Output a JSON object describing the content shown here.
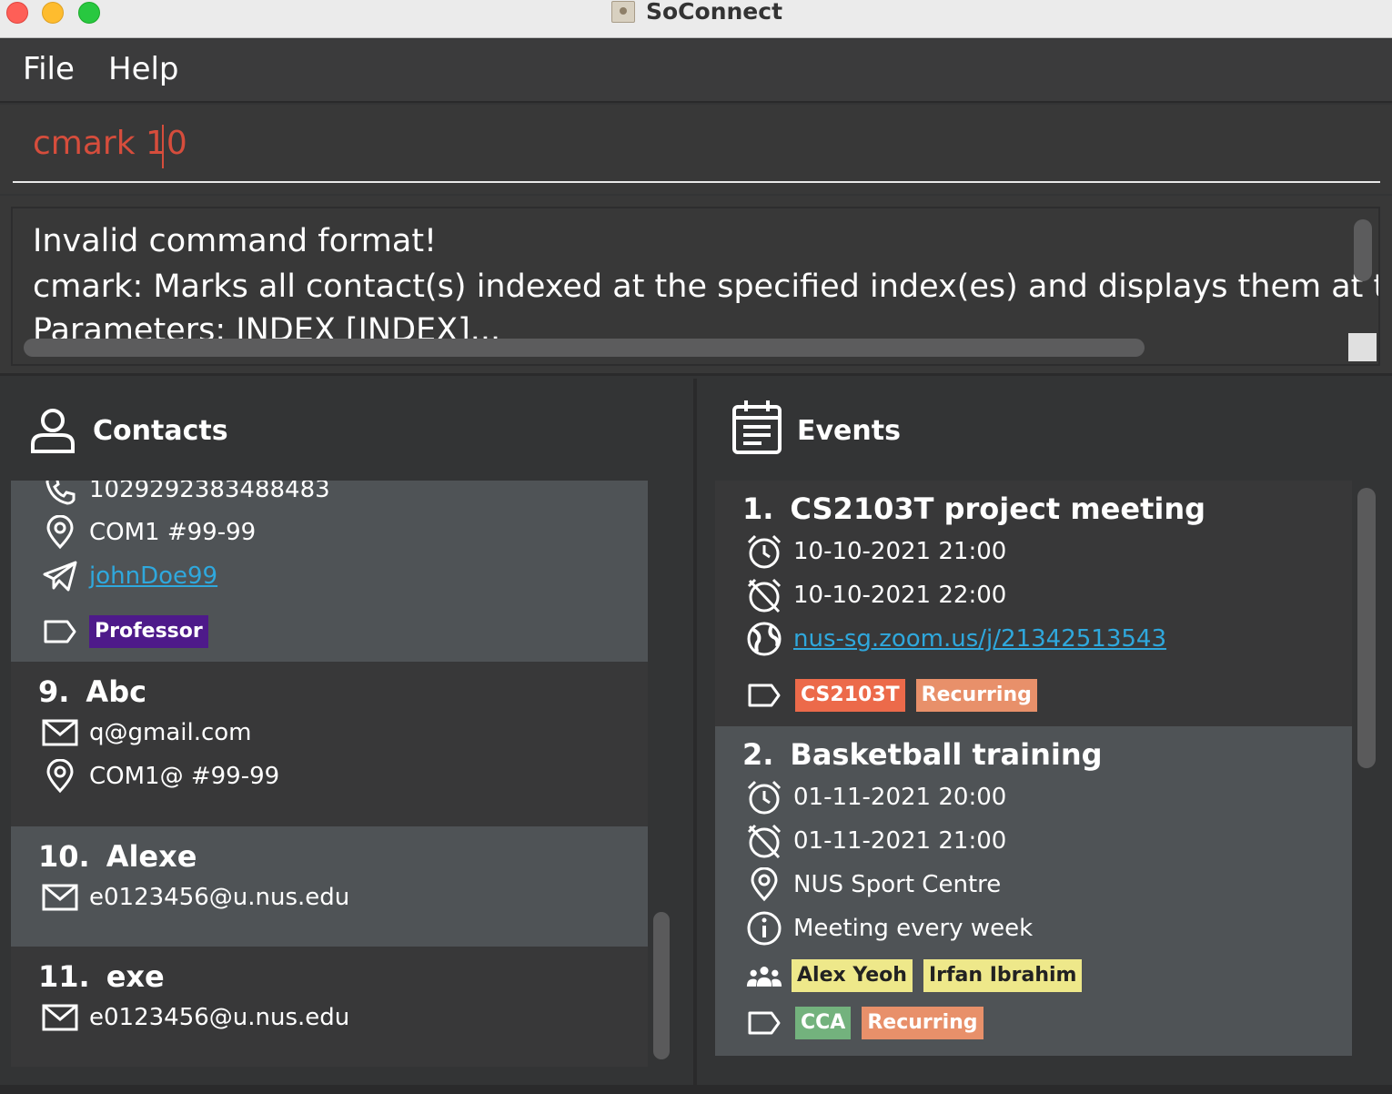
{
  "window": {
    "title": "SoConnect"
  },
  "menu": {
    "file": "File",
    "help": "Help"
  },
  "command": {
    "value": "cmark 10"
  },
  "result": {
    "line1": "Invalid command format!",
    "line2": "cmark: Marks all contact(s) indexed at the specified index(es) and displays them at the top of t",
    "line3": "Parameters: INDEX [INDEX]..."
  },
  "contacts": {
    "title": "Contacts",
    "partial": {
      "phone": "1029292383488483",
      "address": "COM1 #99-99",
      "telegram": "johnDoe99",
      "tags": [
        "Professor"
      ]
    },
    "items": [
      {
        "index": "9.",
        "name": "Abc",
        "email": "q@gmail.com",
        "address": "COM1@ #99-99"
      },
      {
        "index": "10.",
        "name": "Alexe",
        "email": "e0123456@u.nus.edu"
      },
      {
        "index": "11.",
        "name": "exe",
        "email": "e0123456@u.nus.edu"
      }
    ]
  },
  "events": {
    "title": "Events",
    "items": [
      {
        "index": "1.",
        "name": "CS2103T project meeting",
        "start": "10-10-2021 21:00",
        "end": "10-10-2021 22:00",
        "link": "nus-sg.zoom.us/j/21342513543",
        "tags": [
          "CS2103T",
          "Recurring"
        ]
      },
      {
        "index": "2.",
        "name": "Basketball training",
        "start": "01-11-2021 20:00",
        "end": "01-11-2021 21:00",
        "location": "NUS Sport Centre",
        "description": "Meeting every week",
        "participants": [
          "Alex Yeoh",
          "Irfan Ibrahim"
        ],
        "tags": [
          "CCA",
          "Recurring"
        ]
      }
    ]
  },
  "colors": {
    "command_text": "#d64d3c",
    "link": "#2fa8dd",
    "tag_professor": "#4e1a8a",
    "tag_cs2103t": "#ec6a4a",
    "tag_recurring": "#e8906a",
    "tag_cca": "#73b27d",
    "tag_participant": "#eee88a"
  }
}
